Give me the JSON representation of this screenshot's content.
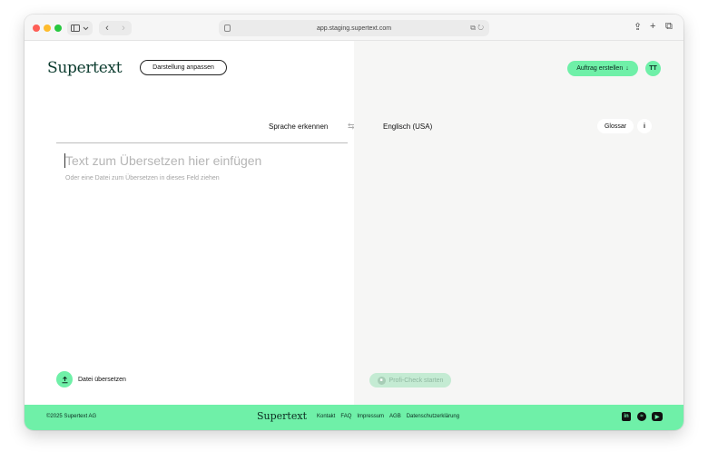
{
  "browser": {
    "url": "app.staging.supertext.com",
    "back_glyph": "‹",
    "forward_glyph": "›",
    "icons": [
      "sidebar-icon",
      "chevron-down-icon",
      "back-icon",
      "forward-icon",
      "translate-icon",
      "reload-icon",
      "share-icon",
      "new-tab-icon",
      "tabs-overview-icon"
    ]
  },
  "header": {
    "logo": "Supertext",
    "display_button": "Darstellung anpassen",
    "cta_button": "Auftrag erstellen",
    "cta_icon": "↓",
    "avatar": "TT"
  },
  "translator": {
    "source_language": "Sprache erkennen",
    "swap_icon": "⇆",
    "target_language": "Englisch (USA)",
    "glossary_button": "Glossar",
    "info_button": "i",
    "input_placeholder": "Text zum Übersetzen hier einfügen",
    "input_hint": "Oder eine Datei zum Übersetzen in dieses Feld ziehen",
    "upload_label": "Datei übersetzen",
    "profi_check_button": "Profi-Check starten"
  },
  "footer": {
    "copyright": "©2025 Supertext AG",
    "logo": "Supertext",
    "links": [
      "Kontakt",
      "FAQ",
      "Impressum",
      "AGB",
      "Datenschutzerklärung"
    ],
    "social": [
      "linkedin-icon",
      "spotify-icon",
      "youtube-icon"
    ]
  },
  "colors": {
    "accent": "#6ff0a8",
    "brand_dark": "#0b3b2e",
    "right_pane_bg": "#f6f6f5"
  }
}
